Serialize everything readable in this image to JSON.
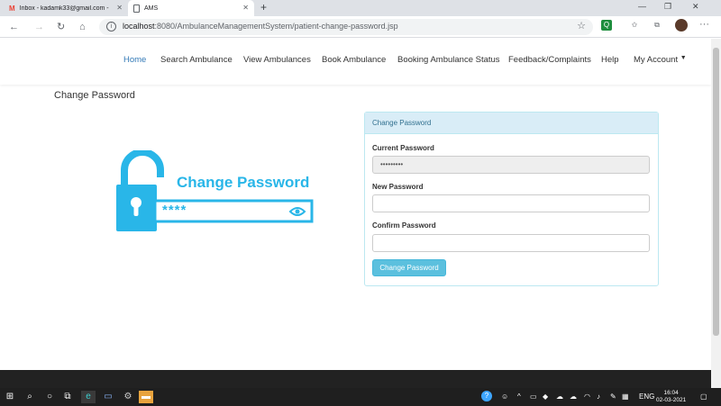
{
  "browser": {
    "tabs": [
      {
        "title": "Inbox - kadamk33@gmail.com -",
        "icon": "gmail-icon"
      },
      {
        "title": "AMS",
        "icon": "page-icon"
      }
    ],
    "url_host": "localhost",
    "url_path": ":8080/AmbulanceManagementSystem/patient-change-password.jsp"
  },
  "navbar": {
    "links": [
      "Home",
      "Search Ambulance",
      "View Ambulances",
      "Book Ambulance",
      "Booking Ambulance Status",
      "Feedback/Complaints",
      "Help",
      "My Account"
    ],
    "active": "Home",
    "accent": "#337ab7"
  },
  "page": {
    "heading": "Change Password"
  },
  "illustration": {
    "title": "Change Password",
    "masked": "****",
    "color": "#29b6e8"
  },
  "form": {
    "panel_title": "Change Password",
    "current_label": "Current Password",
    "current_value": "•••••••••",
    "new_label": "New Password",
    "new_value": "",
    "confirm_label": "Confirm Password",
    "confirm_value": "",
    "submit_label": "Change Password",
    "button_color": "#5bc0de"
  },
  "taskbar": {
    "language": "ENG",
    "time": "16:04",
    "date": "02-03-2021"
  }
}
